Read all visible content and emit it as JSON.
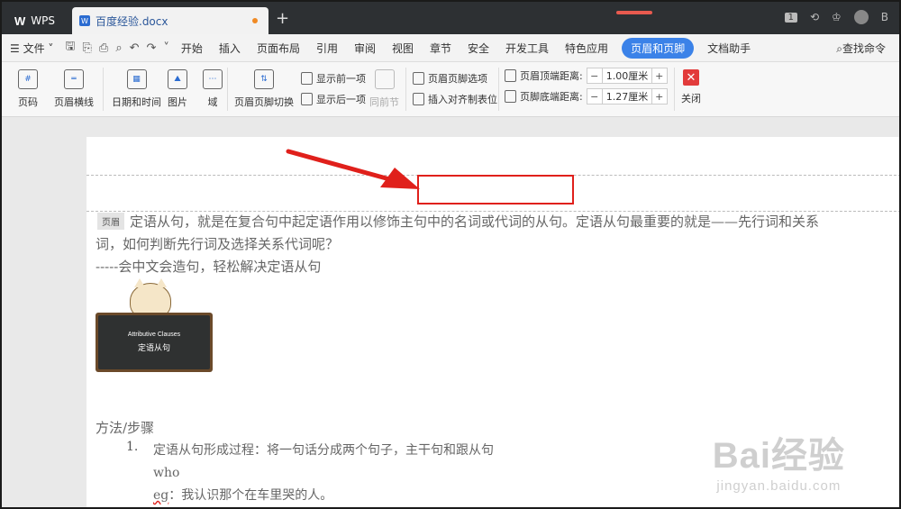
{
  "titlebar": {
    "app_label": "WPS",
    "doc_tab_label": "百度经验.docx",
    "page_count": "1",
    "user_initial": "B"
  },
  "menubar": {
    "file_label": "文件",
    "tabs": [
      "开始",
      "插入",
      "页面布局",
      "引用",
      "审阅",
      "视图",
      "章节",
      "安全",
      "开发工具",
      "特色应用"
    ],
    "active_tab": "页眉和页脚",
    "doc_helper": "文档助手",
    "search_label": "查找命令"
  },
  "ribbon": {
    "page_num": "页码",
    "header_line": "页眉横线",
    "date_time": "日期和时间",
    "picture": "图片",
    "field": "域",
    "switch": "页眉页脚切换",
    "show_prev": "显示前一项",
    "show_next": "显示后一项",
    "same_as_prev": "同前节",
    "options": "页眉页脚选项",
    "insert_tab": "插入对齐制表位",
    "header_top_label": "页眉顶端距离:",
    "header_top_value": "1.00厘米",
    "footer_bottom_label": "页脚底端距离:",
    "footer_bottom_value": "1.27厘米",
    "close": "关闭"
  },
  "document": {
    "header_tag": "页眉",
    "p1": "定语从句，就是在复合句中起定语作用以修饰主句中的名词或代词的从句。定语从句最重要的就是——先行词和关系",
    "p2": "词，如何判断先行词及选择关系代词呢？",
    "p3": "-----会中文会造句，轻松解决定语从句",
    "image_title": "Attributive Clauses",
    "image_subtitle": "定语从句",
    "method_heading": "方法/步骤",
    "list_num": "1.",
    "li1": "定语从句形成过程：将一句话分成两个句子，主干句和跟从句",
    "li2": "who",
    "li3_eg": "eg",
    "li3_rest": "：我认识那个在车里哭的人。"
  },
  "watermark": {
    "brand": "Bai经验",
    "url": "jingyan.baidu.com"
  },
  "colors": {
    "accent": "#3b82e8",
    "highlight": "#e0201b"
  }
}
